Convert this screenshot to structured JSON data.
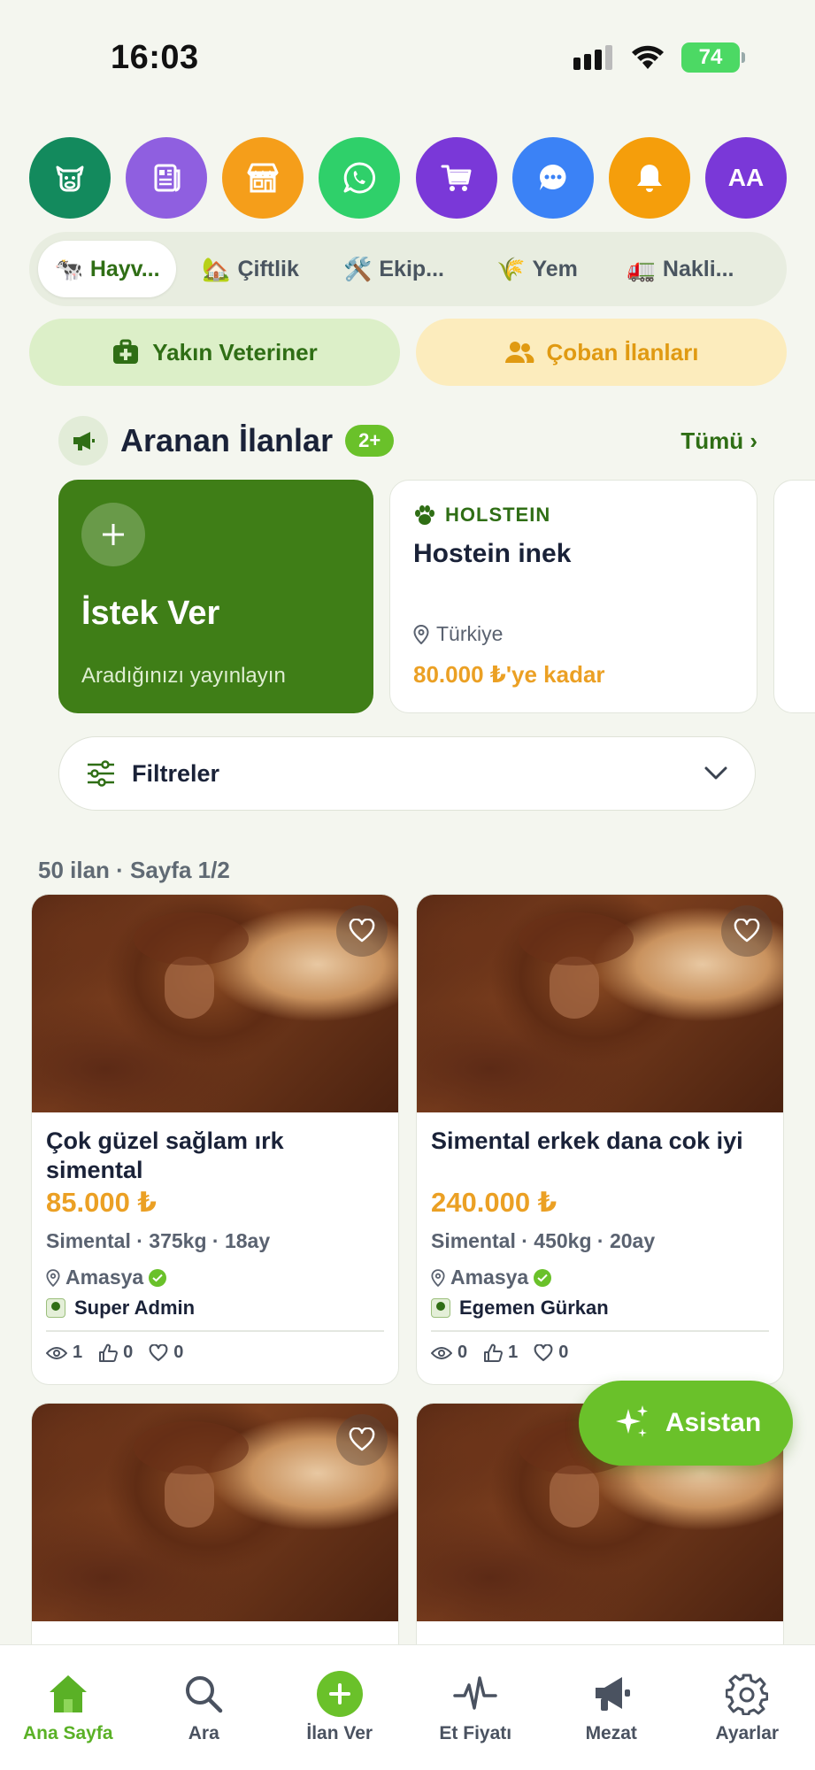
{
  "status_bar": {
    "time": "16:03",
    "battery": "74"
  },
  "quick_actions": [
    {
      "name": "cow-icon",
      "color": "#138a5d"
    },
    {
      "name": "news-icon",
      "color": "#8f5fe0"
    },
    {
      "name": "store-icon",
      "color": "#f59e1a"
    },
    {
      "name": "whatsapp-icon",
      "color": "#2fd06a"
    },
    {
      "name": "cart-icon",
      "color": "#7a38d8"
    },
    {
      "name": "chat-icon",
      "color": "#3b82f6"
    },
    {
      "name": "bell-icon",
      "color": "#f59e0b"
    },
    {
      "name": "profile-avatar",
      "color": "#7a38d8",
      "label": "AA"
    }
  ],
  "categories": [
    {
      "emoji": "🐄",
      "label": "Hayv...",
      "active": true
    },
    {
      "emoji": "🏡",
      "label": "Çiftlik",
      "active": false
    },
    {
      "emoji": "🛠️",
      "label": "Ekip...",
      "active": false
    },
    {
      "emoji": "🌾",
      "label": "Yem",
      "active": false
    },
    {
      "emoji": "🚛",
      "label": "Nakli...",
      "active": false
    }
  ],
  "pills": {
    "vet": "Yakın Veteriner",
    "coban": "Çoban İlanları"
  },
  "wanted": {
    "title": "Aranan İlanlar",
    "badge": "2+",
    "see_all": "Tümü ›",
    "add_card": {
      "title": "İstek Ver",
      "subtitle": "Aradığınızı yayınlayın"
    },
    "requests": [
      {
        "breed": "HOLSTEIN",
        "name": "Hostein inek",
        "location": "Türkiye",
        "price": "80.000 ₺'ye kadar"
      }
    ]
  },
  "filters": {
    "label": "Filtreler"
  },
  "results": {
    "summary": "50 ilan · Sayfa 1/2"
  },
  "listings": [
    {
      "title": "Çok güzel sağlam ırk simental",
      "price": "85.000 ₺",
      "meta": "Simental · 375kg · 18ay",
      "location": "Amasya",
      "seller": "Super Admin",
      "views": "1",
      "likes": "0",
      "favs": "0"
    },
    {
      "title": "Simental erkek dana cok iyi",
      "price": "240.000 ₺",
      "meta": "Simental · 450kg · 20ay",
      "location": "Amasya",
      "seller": "Egemen Gürkan",
      "views": "0",
      "likes": "1",
      "favs": "0"
    },
    {
      "title": "",
      "price": "",
      "meta": "",
      "location": "",
      "seller": "",
      "views": "",
      "likes": "",
      "favs": ""
    },
    {
      "title": "",
      "price": "",
      "meta": "",
      "location": "",
      "seller": "",
      "views": "",
      "likes": "",
      "favs": ""
    }
  ],
  "assistant": {
    "label": "Asistan"
  },
  "bottom_nav": [
    {
      "label": "Ana Sayfa",
      "icon": "home-icon",
      "active": true
    },
    {
      "label": "Ara",
      "icon": "search-icon",
      "active": false
    },
    {
      "label": "İlan Ver",
      "icon": "plus-icon",
      "active": false
    },
    {
      "label": "Et Fiyatı",
      "icon": "pulse-icon",
      "active": false
    },
    {
      "label": "Mezat",
      "icon": "megaphone-icon",
      "active": false
    },
    {
      "label": "Ayarlar",
      "icon": "settings-icon",
      "active": false
    }
  ]
}
